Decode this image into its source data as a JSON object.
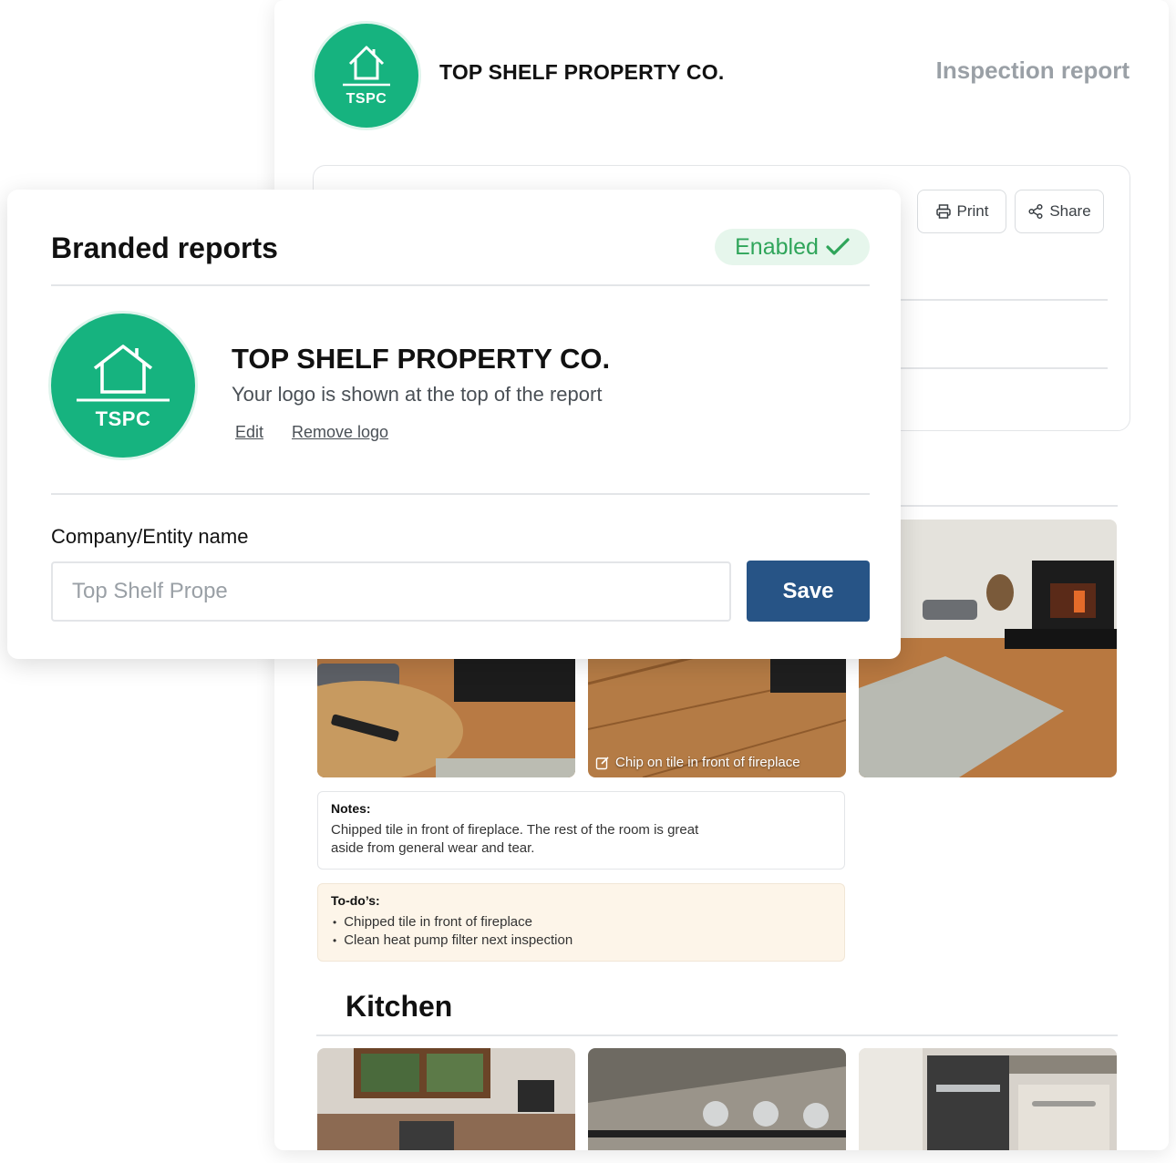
{
  "report": {
    "logo_initials": "TSPC",
    "company_name": "TOP SHELF PROPERTY CO.",
    "title": "Inspection report",
    "print_label": "Print",
    "share_label": "Share",
    "photo_caption": "Chip on tile in front of fireplace",
    "notes_label": "Notes:",
    "notes_text": "Chipped tile in front of fireplace. The rest of the room is great aside from general wear and tear.",
    "todos_label": "To-do’s:",
    "todos": [
      "Chipped tile in front of fireplace",
      "Clean heat pump filter next inspection"
    ],
    "kitchen_title": "Kitchen"
  },
  "modal": {
    "title": "Branded reports",
    "status": "Enabled",
    "logo_initials": "TSPC",
    "company_name": "TOP SHELF PROPERTY CO.",
    "subtitle": "Your logo is shown at the top of the report",
    "edit_label": "Edit",
    "remove_label": "Remove logo",
    "field_label": "Company/Entity name",
    "field_value": "Top Shelf Prope",
    "save_label": "Save"
  },
  "colors": {
    "brand_green": "#16b37f",
    "status_green": "#2fa55a",
    "save_blue": "#275486",
    "todo_bg": "#fdf5e9"
  }
}
